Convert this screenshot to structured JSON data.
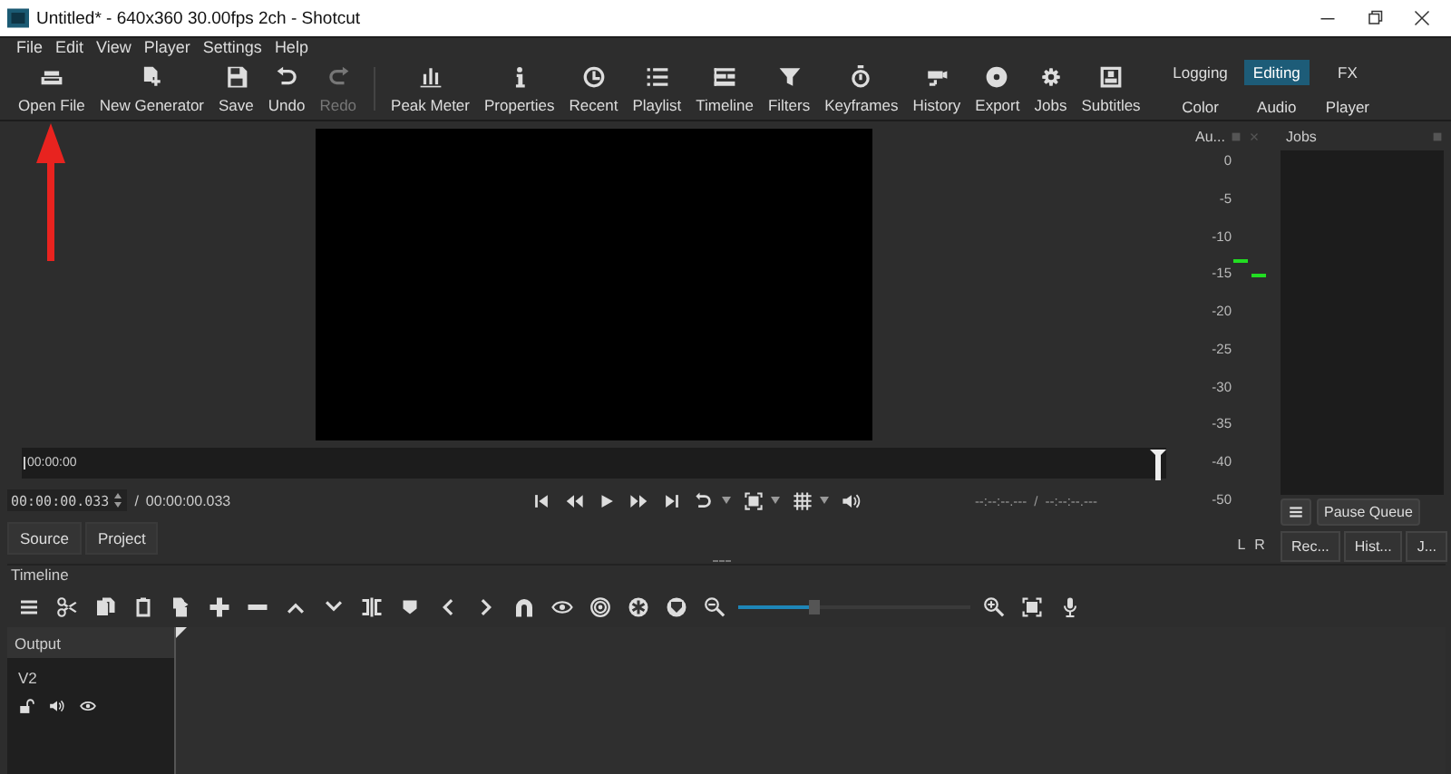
{
  "window": {
    "title": "Untitled* - 640x360 30.00fps 2ch - Shotcut"
  },
  "menu": [
    "File",
    "Edit",
    "View",
    "Player",
    "Settings",
    "Help"
  ],
  "toolbar": [
    {
      "label": "Open File",
      "disabled": false
    },
    {
      "label": "New Generator",
      "disabled": false
    },
    {
      "label": "Save",
      "disabled": false
    },
    {
      "label": "Undo",
      "disabled": false
    },
    {
      "label": "Redo",
      "disabled": true
    },
    {
      "label": "Peak Meter",
      "disabled": false
    },
    {
      "label": "Properties",
      "disabled": false
    },
    {
      "label": "Recent",
      "disabled": false
    },
    {
      "label": "Playlist",
      "disabled": false
    },
    {
      "label": "Timeline",
      "disabled": false
    },
    {
      "label": "Filters",
      "disabled": false
    },
    {
      "label": "Keyframes",
      "disabled": false
    },
    {
      "label": "History",
      "disabled": false
    },
    {
      "label": "Export",
      "disabled": false
    },
    {
      "label": "Jobs",
      "disabled": false
    },
    {
      "label": "Subtitles",
      "disabled": false
    }
  ],
  "layouts": [
    {
      "label": "Logging",
      "selected": false
    },
    {
      "label": "Editing",
      "selected": true
    },
    {
      "label": "FX",
      "selected": false
    },
    {
      "label": "Color",
      "selected": false
    },
    {
      "label": "Audio",
      "selected": false
    },
    {
      "label": "Player",
      "selected": false
    }
  ],
  "player": {
    "scrub_time": "00:00:00",
    "position": "00:00:00.033",
    "separator": "/",
    "duration": "00:00:00.033",
    "in_point": "--:--:--.---",
    "in_out_separator": "/",
    "out_point": "--:--:--.---",
    "tabs": [
      "Source",
      "Project"
    ]
  },
  "audio_meter": {
    "title": "Au...",
    "scale": [
      "0",
      "-5",
      "-10",
      "-15",
      "-20",
      "-25",
      "-30",
      "-35",
      "-40",
      "-50"
    ],
    "channels": [
      {
        "name": "L",
        "level": 0.69
      },
      {
        "name": "R",
        "level": 0.65
      }
    ]
  },
  "jobs": {
    "title": "Jobs",
    "pause_button": "Pause Queue",
    "tabs": [
      "Rec...",
      "Hist...",
      "J..."
    ]
  },
  "timeline": {
    "title": "Timeline",
    "zoom": {
      "level": 0.33
    },
    "output_label": "Output",
    "tracks": [
      {
        "name": "V2"
      }
    ]
  }
}
